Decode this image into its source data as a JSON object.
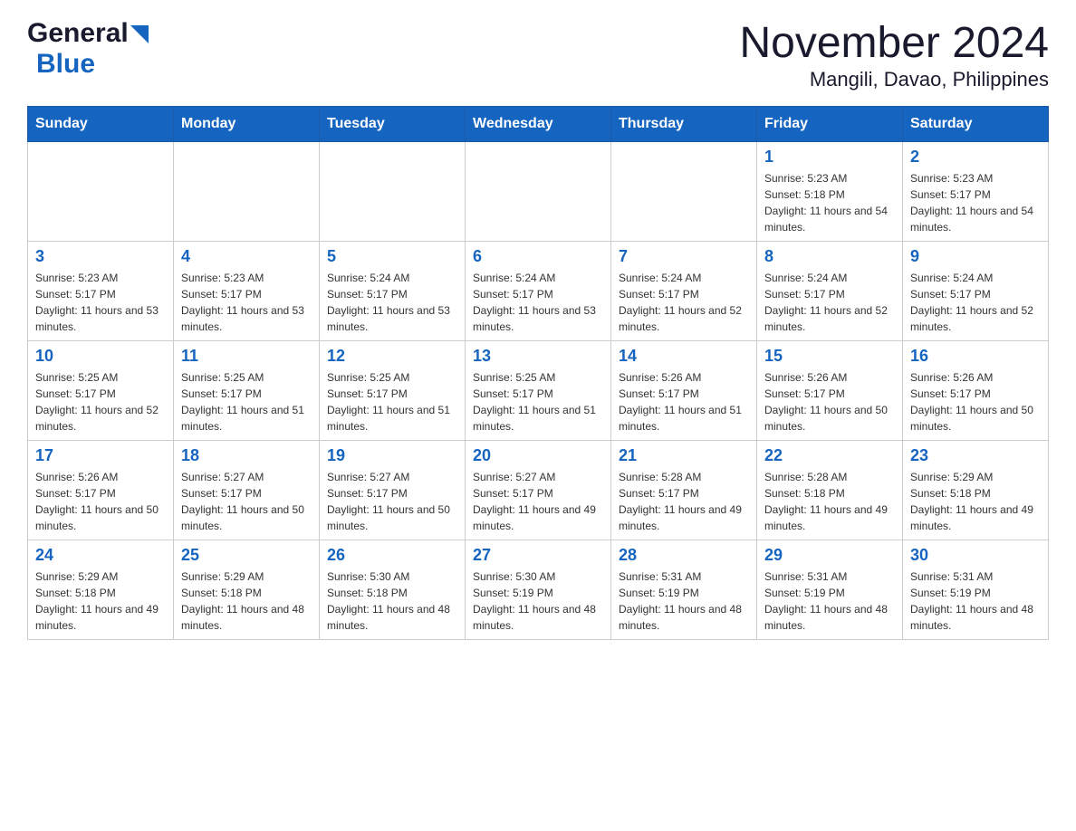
{
  "header": {
    "logo": {
      "general": "General",
      "blue": "Blue",
      "tagline": ""
    },
    "title": "November 2024",
    "subtitle": "Mangili, Davao, Philippines"
  },
  "weekdays": [
    "Sunday",
    "Monday",
    "Tuesday",
    "Wednesday",
    "Thursday",
    "Friday",
    "Saturday"
  ],
  "weeks": [
    [
      {
        "day": "",
        "info": ""
      },
      {
        "day": "",
        "info": ""
      },
      {
        "day": "",
        "info": ""
      },
      {
        "day": "",
        "info": ""
      },
      {
        "day": "",
        "info": ""
      },
      {
        "day": "1",
        "info": "Sunrise: 5:23 AM\nSunset: 5:18 PM\nDaylight: 11 hours and 54 minutes."
      },
      {
        "day": "2",
        "info": "Sunrise: 5:23 AM\nSunset: 5:17 PM\nDaylight: 11 hours and 54 minutes."
      }
    ],
    [
      {
        "day": "3",
        "info": "Sunrise: 5:23 AM\nSunset: 5:17 PM\nDaylight: 11 hours and 53 minutes."
      },
      {
        "day": "4",
        "info": "Sunrise: 5:23 AM\nSunset: 5:17 PM\nDaylight: 11 hours and 53 minutes."
      },
      {
        "day": "5",
        "info": "Sunrise: 5:24 AM\nSunset: 5:17 PM\nDaylight: 11 hours and 53 minutes."
      },
      {
        "day": "6",
        "info": "Sunrise: 5:24 AM\nSunset: 5:17 PM\nDaylight: 11 hours and 53 minutes."
      },
      {
        "day": "7",
        "info": "Sunrise: 5:24 AM\nSunset: 5:17 PM\nDaylight: 11 hours and 52 minutes."
      },
      {
        "day": "8",
        "info": "Sunrise: 5:24 AM\nSunset: 5:17 PM\nDaylight: 11 hours and 52 minutes."
      },
      {
        "day": "9",
        "info": "Sunrise: 5:24 AM\nSunset: 5:17 PM\nDaylight: 11 hours and 52 minutes."
      }
    ],
    [
      {
        "day": "10",
        "info": "Sunrise: 5:25 AM\nSunset: 5:17 PM\nDaylight: 11 hours and 52 minutes."
      },
      {
        "day": "11",
        "info": "Sunrise: 5:25 AM\nSunset: 5:17 PM\nDaylight: 11 hours and 51 minutes."
      },
      {
        "day": "12",
        "info": "Sunrise: 5:25 AM\nSunset: 5:17 PM\nDaylight: 11 hours and 51 minutes."
      },
      {
        "day": "13",
        "info": "Sunrise: 5:25 AM\nSunset: 5:17 PM\nDaylight: 11 hours and 51 minutes."
      },
      {
        "day": "14",
        "info": "Sunrise: 5:26 AM\nSunset: 5:17 PM\nDaylight: 11 hours and 51 minutes."
      },
      {
        "day": "15",
        "info": "Sunrise: 5:26 AM\nSunset: 5:17 PM\nDaylight: 11 hours and 50 minutes."
      },
      {
        "day": "16",
        "info": "Sunrise: 5:26 AM\nSunset: 5:17 PM\nDaylight: 11 hours and 50 minutes."
      }
    ],
    [
      {
        "day": "17",
        "info": "Sunrise: 5:26 AM\nSunset: 5:17 PM\nDaylight: 11 hours and 50 minutes."
      },
      {
        "day": "18",
        "info": "Sunrise: 5:27 AM\nSunset: 5:17 PM\nDaylight: 11 hours and 50 minutes."
      },
      {
        "day": "19",
        "info": "Sunrise: 5:27 AM\nSunset: 5:17 PM\nDaylight: 11 hours and 50 minutes."
      },
      {
        "day": "20",
        "info": "Sunrise: 5:27 AM\nSunset: 5:17 PM\nDaylight: 11 hours and 49 minutes."
      },
      {
        "day": "21",
        "info": "Sunrise: 5:28 AM\nSunset: 5:17 PM\nDaylight: 11 hours and 49 minutes."
      },
      {
        "day": "22",
        "info": "Sunrise: 5:28 AM\nSunset: 5:18 PM\nDaylight: 11 hours and 49 minutes."
      },
      {
        "day": "23",
        "info": "Sunrise: 5:29 AM\nSunset: 5:18 PM\nDaylight: 11 hours and 49 minutes."
      }
    ],
    [
      {
        "day": "24",
        "info": "Sunrise: 5:29 AM\nSunset: 5:18 PM\nDaylight: 11 hours and 49 minutes."
      },
      {
        "day": "25",
        "info": "Sunrise: 5:29 AM\nSunset: 5:18 PM\nDaylight: 11 hours and 48 minutes."
      },
      {
        "day": "26",
        "info": "Sunrise: 5:30 AM\nSunset: 5:18 PM\nDaylight: 11 hours and 48 minutes."
      },
      {
        "day": "27",
        "info": "Sunrise: 5:30 AM\nSunset: 5:19 PM\nDaylight: 11 hours and 48 minutes."
      },
      {
        "day": "28",
        "info": "Sunrise: 5:31 AM\nSunset: 5:19 PM\nDaylight: 11 hours and 48 minutes."
      },
      {
        "day": "29",
        "info": "Sunrise: 5:31 AM\nSunset: 5:19 PM\nDaylight: 11 hours and 48 minutes."
      },
      {
        "day": "30",
        "info": "Sunrise: 5:31 AM\nSunset: 5:19 PM\nDaylight: 11 hours and 48 minutes."
      }
    ]
  ]
}
